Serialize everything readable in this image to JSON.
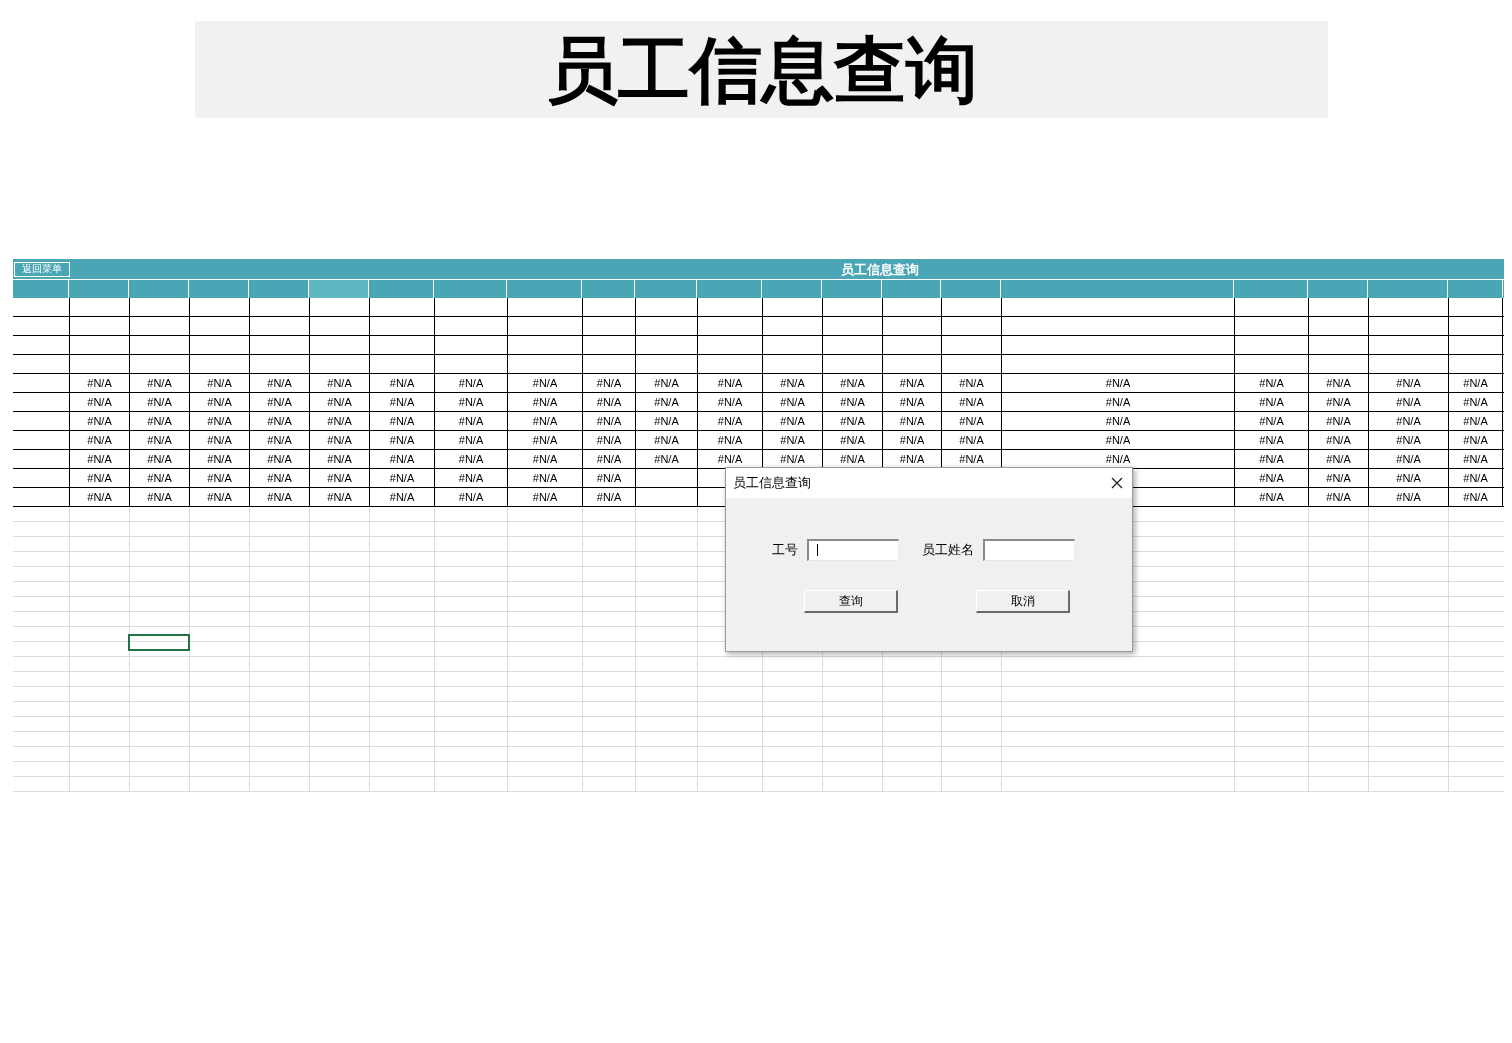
{
  "title": "员工信息查询",
  "sheet": {
    "menu_button": "返回菜单",
    "banner": "员工信息查询",
    "rows": [
      [
        "#N/A",
        "#N/A",
        "#N/A",
        "#N/A",
        "#N/A",
        "#N/A",
        "#N/A",
        "#N/A",
        "#N/A",
        "#N/A",
        "#N/A",
        "#N/A",
        "#N/A",
        "#N/A",
        "#N/A",
        "#N/A",
        "#N/A",
        "#N/A",
        "#N/A",
        "#N/A"
      ],
      [
        "#N/A",
        "#N/A",
        "#N/A",
        "#N/A",
        "#N/A",
        "#N/A",
        "#N/A",
        "#N/A",
        "#N/A",
        "#N/A",
        "#N/A",
        "#N/A",
        "#N/A",
        "#N/A",
        "#N/A",
        "#N/A",
        "#N/A",
        "#N/A",
        "#N/A",
        "#N/A"
      ],
      [
        "#N/A",
        "#N/A",
        "#N/A",
        "#N/A",
        "#N/A",
        "#N/A",
        "#N/A",
        "#N/A",
        "#N/A",
        "#N/A",
        "#N/A",
        "#N/A",
        "#N/A",
        "#N/A",
        "#N/A",
        "#N/A",
        "#N/A",
        "#N/A",
        "#N/A",
        "#N/A"
      ],
      [
        "#N/A",
        "#N/A",
        "#N/A",
        "#N/A",
        "#N/A",
        "#N/A",
        "#N/A",
        "#N/A",
        "#N/A",
        "#N/A",
        "#N/A",
        "#N/A",
        "#N/A",
        "#N/A",
        "#N/A",
        "#N/A",
        "#N/A",
        "#N/A",
        "#N/A",
        "#N/A"
      ],
      [
        "#N/A",
        "#N/A",
        "#N/A",
        "#N/A",
        "#N/A",
        "#N/A",
        "#N/A",
        "#N/A",
        "#N/A",
        "#N/A",
        "#N/A",
        "#N/A",
        "#N/A",
        "#N/A",
        "#N/A",
        "#N/A",
        "#N/A",
        "#N/A",
        "#N/A",
        "#N/A"
      ],
      [
        "#N/A",
        "#N/A",
        "#N/A",
        "#N/A",
        "#N/A",
        "#N/A",
        "#N/A",
        "#N/A",
        "#N/A",
        null,
        null,
        null,
        null,
        null,
        null,
        null,
        "#N/A",
        "#N/A",
        "#N/A",
        "#N/A"
      ],
      [
        "#N/A",
        "#N/A",
        "#N/A",
        "#N/A",
        "#N/A",
        "#N/A",
        "#N/A",
        "#N/A",
        "#N/A",
        null,
        null,
        null,
        null,
        null,
        null,
        null,
        "#N/A",
        "#N/A",
        "#N/A",
        "#N/A"
      ]
    ]
  },
  "dialog": {
    "title": "员工信息查询",
    "fields": [
      {
        "label": "工号",
        "focused": true
      },
      {
        "label": "员工姓名",
        "focused": false
      }
    ],
    "buttons": [
      "查询",
      "取消"
    ]
  }
}
